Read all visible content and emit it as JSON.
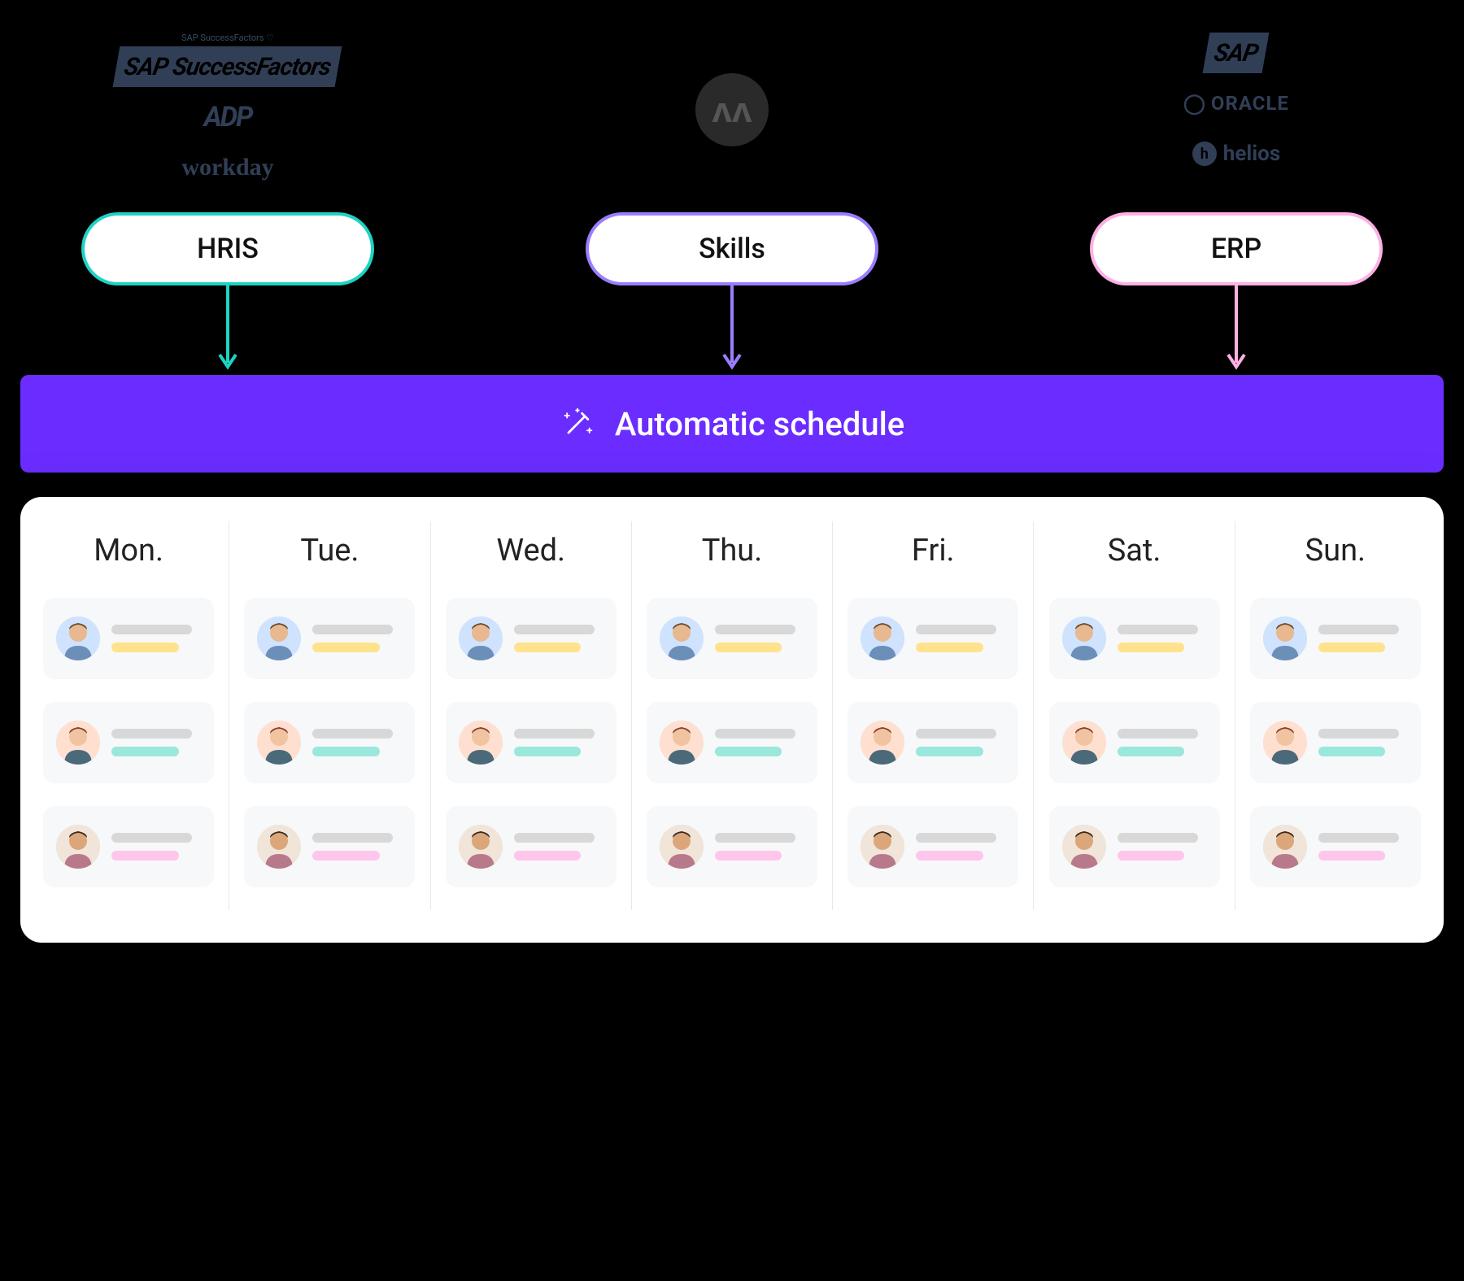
{
  "sources": {
    "hris": {
      "logos": [
        "SAP SuccessFactors",
        "ADP",
        "workday"
      ]
    },
    "skills": {
      "logo": "M"
    },
    "erp": {
      "logos": [
        "SAP",
        "ORACLE",
        "helios"
      ]
    }
  },
  "pills": {
    "hris": {
      "label": "HRIS",
      "color": "#1dd3c4"
    },
    "skills": {
      "label": "Skills",
      "color": "#9b7dff"
    },
    "erp": {
      "label": "ERP",
      "color": "#ffb0e5"
    }
  },
  "banner": {
    "label": "Automatic schedule",
    "icon": "wand-sparkle-icon"
  },
  "schedule": {
    "days": [
      "Mon.",
      "Tue.",
      "Wed.",
      "Thu.",
      "Fri.",
      "Sat.",
      "Sun."
    ],
    "rows": [
      {
        "avatar": "person-1",
        "accent": "yellow"
      },
      {
        "avatar": "person-2",
        "accent": "teal"
      },
      {
        "avatar": "person-3",
        "accent": "pink"
      }
    ]
  }
}
